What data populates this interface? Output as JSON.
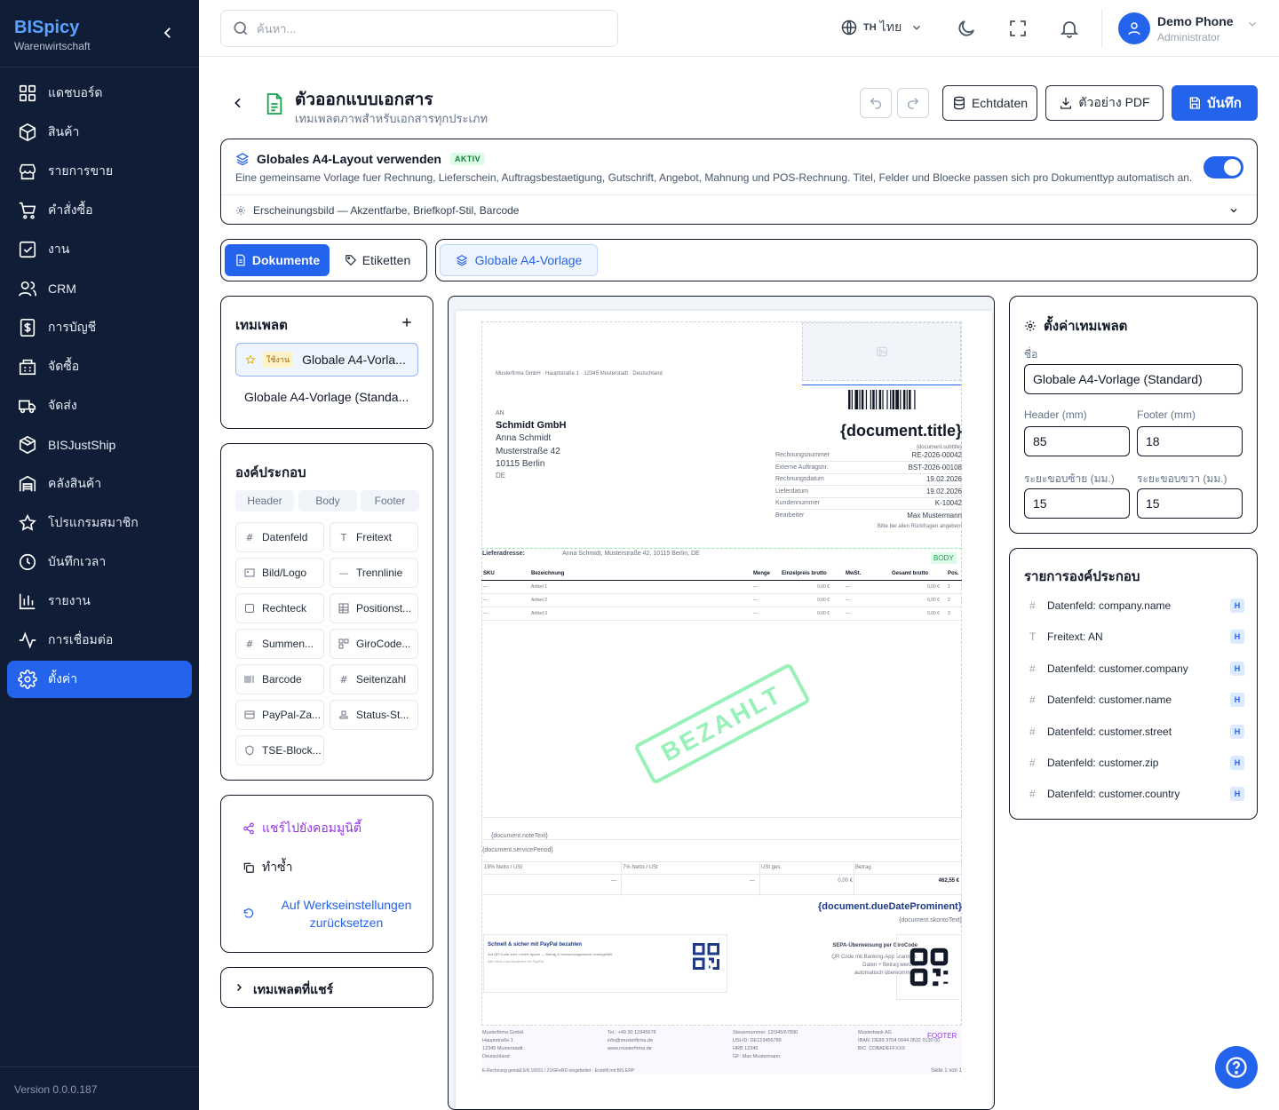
{
  "sidebar": {
    "brand": "BISpicy",
    "brand_sub": "Warenwirtschaft",
    "items": [
      {
        "label": "แดชบอร์ด",
        "icon": "dashboard-icon"
      },
      {
        "label": "สินค้า",
        "icon": "box-icon"
      },
      {
        "label": "รายการขาย",
        "icon": "store-icon"
      },
      {
        "label": "คำสั่งซื้อ",
        "icon": "cart-icon"
      },
      {
        "label": "งาน",
        "icon": "task-icon"
      },
      {
        "label": "CRM",
        "icon": "users-icon"
      },
      {
        "label": "การบัญชี",
        "icon": "accounting-icon"
      },
      {
        "label": "จัดซื้อ",
        "icon": "purchasing-icon"
      },
      {
        "label": "จัดส่ง",
        "icon": "truck-icon"
      },
      {
        "label": "BISJustShip",
        "icon": "package-icon"
      },
      {
        "label": "คลังสินค้า",
        "icon": "warehouse-icon"
      },
      {
        "label": "โปรแกรมสมาชิก",
        "icon": "star-icon"
      },
      {
        "label": "บันทึกเวลา",
        "icon": "clock-icon"
      },
      {
        "label": "รายงาน",
        "icon": "report-icon"
      },
      {
        "label": "การเชื่อมต่อ",
        "icon": "activity-icon"
      },
      {
        "label": "ตั้งค่า",
        "icon": "gear-icon"
      }
    ],
    "version": "Version 0.0.0.187"
  },
  "topbar": {
    "search_placeholder": "ค้นหา...",
    "lang_code": "TH",
    "lang_label": "ไทย",
    "user_name": "Demo Phone",
    "user_role": "Administrator"
  },
  "header": {
    "title": "ตัวออกแบบเอกสาร",
    "subtitle": "เทมเพลตภาพสำหรับเอกสารทุกประเภท",
    "btn_realdata": "Echtdaten",
    "btn_pdf": "ตัวอย่าง PDF",
    "btn_save": "บันทึก"
  },
  "global": {
    "title": "Globales A4-Layout verwenden",
    "badge": "AKTIV",
    "desc": "Eine gemeinsame Vorlage fuer Rechnung, Lieferschein, Auftragsbestaetigung, Gutschrift, Angebot, Mahnung und POS-Rechnung. Titel, Felder und Bloecke passen sich pro Dokumenttyp automatisch an.",
    "appearance": "Erscheinungsbild — Akzentfarbe, Briefkopf-Stil, Barcode"
  },
  "tabs": {
    "documents": "Dokumente",
    "labels": "Etiketten",
    "global_tpl": "Globale A4-Vorlage"
  },
  "templates": {
    "title": "เทมเพลต",
    "active_badge": "ใช้งาน",
    "items": [
      "Globale A4-Vorla...",
      "Globale A4-Vorlage (Standa..."
    ]
  },
  "components": {
    "title": "องค์ประกอบ",
    "segments": [
      "Header",
      "Body",
      "Footer"
    ],
    "items": [
      "Datenfeld",
      "Freitext",
      "Bild/Logo",
      "Trennlinie",
      "Rechteck",
      "Positionst...",
      "Summen...",
      "GiroCode...",
      "Barcode",
      "Seitenzahl",
      "PayPal-Za...",
      "Status-St...",
      "TSE-Block..."
    ]
  },
  "actions": {
    "share": "แชร์ไปยังคอมมูนิตี้",
    "copy": "ทำซ้ำ",
    "reset": "Auf Werkseinstellungen zurücksetzen"
  },
  "shared": "เทมเพลตที่แชร์",
  "settings": {
    "title": "ตั้งค่าเทมเพลต",
    "name_label": "ชื่อ",
    "name_value": "Globale A4-Vorlage (Standard)",
    "header_label": "Header (mm)",
    "header_value": "85",
    "footer_label": "Footer (mm)",
    "footer_value": "18",
    "ml_label": "ระยะขอบซ้าย (มม.)",
    "ml_value": "15",
    "mr_label": "ระยะขอบขวา (มม.)",
    "mr_value": "15"
  },
  "complist": {
    "title": "รายการองค์ประกอบ",
    "badge": "H",
    "items": [
      {
        "label": "Datenfeld: company.name",
        "icon": "#"
      },
      {
        "label": "Freitext: AN",
        "icon": "T"
      },
      {
        "label": "Datenfeld: customer.company",
        "icon": "#"
      },
      {
        "label": "Datenfeld: customer.name",
        "icon": "#"
      },
      {
        "label": "Datenfeld: customer.street",
        "icon": "#"
      },
      {
        "label": "Datenfeld: customer.zip",
        "icon": "#"
      },
      {
        "label": "Datenfeld: customer.country",
        "icon": "#"
      }
    ]
  },
  "doc": {
    "sender": "Musterfirma GmbH · Hauptstraße 1 · 12345 Musterstadt · Deutschland",
    "an": "AN",
    "company": "Schmidt GmbH",
    "person": "Anna Schmidt",
    "street": "Musterstraße 42",
    "city": "10115 Berlin",
    "country": "DE",
    "title": "{document.title}",
    "subtitle": "{document.subtitle}",
    "meta": [
      [
        "Rechnungsnummer",
        "RE-2026-00042"
      ],
      [
        "Externe Auftragsnr.",
        "BST-2026-00108"
      ],
      [
        "Rechnungsdatum",
        "19.02.2026"
      ],
      [
        "Lieferdatum",
        "19.02.2026"
      ],
      [
        "Kundennummer",
        "K-10042"
      ],
      [
        "Bearbeiter",
        "Max Mustermann"
      ]
    ],
    "meta_note": "Bitte bei allen Rückfragen angeben!",
    "delivery_label": "Lieferadresse:",
    "delivery_value": "Anna Schmidt, Musterstraße 42, 10115 Berlin, DE",
    "body_tag": "BODY",
    "cols": [
      "SKU",
      "Bezeichnung",
      "Menge",
      "Einzelpreis brutto",
      "MwSt.",
      "Gesamt brutto",
      "Pos."
    ],
    "rows": [
      [
        "—",
        "Artikel 1",
        "—",
        "0,00 €",
        "—",
        "0,00 €",
        "1"
      ],
      [
        "—",
        "Artikel 2",
        "—",
        "0,00 €",
        "—",
        "0,00 €",
        "2"
      ],
      [
        "—",
        "Artikel 3",
        "—",
        "0,00 €",
        "—",
        "0,00 €",
        "3"
      ]
    ],
    "stamp": "BEZAHLT",
    "note": "{document.noteText}",
    "service": "{document.servicePeriod}",
    "tax_cols": [
      "19% Netto / USt",
      "7% Netto / USt",
      "USt ges.",
      "Betrag"
    ],
    "tax_vals": [
      "—",
      "—",
      "0,00 €",
      "462,55 €"
    ],
    "due": "{document.dueDateProminent}",
    "skonto": "{document.skontoText}",
    "paypal_title": "Schnell & sicher mit PayPal bezahlen",
    "paypal_line1": "Auf QR-Code oder «Jetzt» tippen — Betrag & Verwendungszweck voreingefüllt",
    "paypal_line2": "Alle Infos zum Bezahlen mit PayPal",
    "sepa_title": "SEPA-Überweisung per GiroCode",
    "sepa_l1": "QR Code mit Banking-App scannen.",
    "sepa_l2": "Daten + Betrag werden",
    "sepa_l3": "automatisch übernommen.",
    "footer_tag": "FOOTER",
    "f1": [
      "Musterfirma GmbH",
      "Hauptstraße 1",
      "12345 Musterstadt",
      "Deutschland"
    ],
    "f2": [
      "Tel.: +49 30 12345678",
      "info@musterfirma.de",
      "www.musterfirma.de"
    ],
    "f3": [
      "Steuernummer: 12/345/67890",
      "USt-ID: DE123456789",
      "HRB 12345",
      "GF: Max Mustermann"
    ],
    "f4": [
      "Musterbank AG",
      "IBAN: DE89 3704 0044 0532 0130 00",
      "BIC: COBADEFFXXX"
    ],
    "erech": "E-Rechnung gemäß EN 16931 / ZUGFeRD eingebettet · Erstellt mit BIS ERP",
    "pageno": "Seite 1 von 1"
  }
}
